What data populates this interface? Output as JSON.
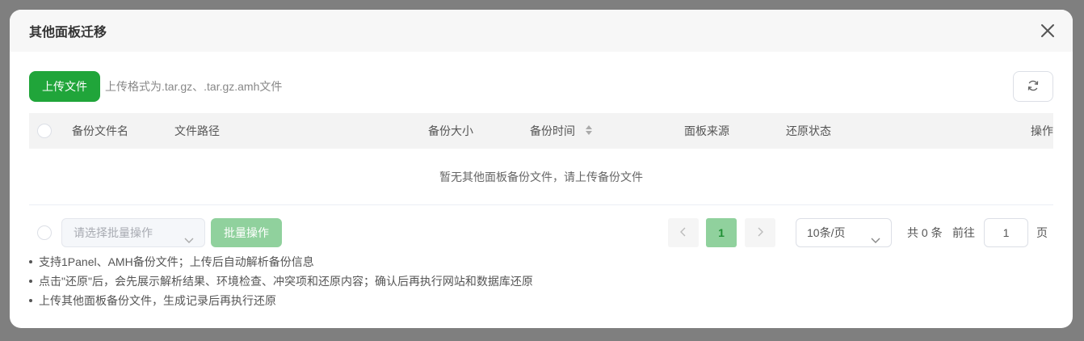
{
  "modal": {
    "title": "其他面板迁移"
  },
  "toolbar": {
    "upload_label": "上传文件",
    "upload_hint": "上传格式为.tar.gz、.tar.gz.amh文件"
  },
  "table": {
    "columns": [
      "备份文件名",
      "文件路径",
      "备份大小",
      "备份时间",
      "面板来源",
      "还原状态",
      "操作"
    ],
    "empty_text": "暂无其他面板备份文件，请上传备份文件"
  },
  "footer": {
    "batch_placeholder": "请选择批量操作",
    "batch_button": "批量操作",
    "current_page": "1",
    "page_size": "10条/页",
    "total": "共 0 条",
    "goto_label": "前往",
    "goto_value": "1",
    "page_unit": "页"
  },
  "notes": [
    "支持1Panel、AMH备份文件；上传后自动解析备份信息",
    "点击\"还原\"后，会先展示解析结果、环境检查、冲突项和还原内容；确认后再执行网站和数据库还原",
    "上传其他面板备份文件，生成记录后再执行还原"
  ],
  "colors": {
    "accent": "#20a53a",
    "accent_light": "#90d19d"
  },
  "icons": {
    "close": "close-icon",
    "refresh": "refresh-icon",
    "sort": "sort-icon",
    "chevron_down": "chevron-down-icon",
    "chevron_left": "chevron-left-icon",
    "chevron_right": "chevron-right-icon"
  }
}
